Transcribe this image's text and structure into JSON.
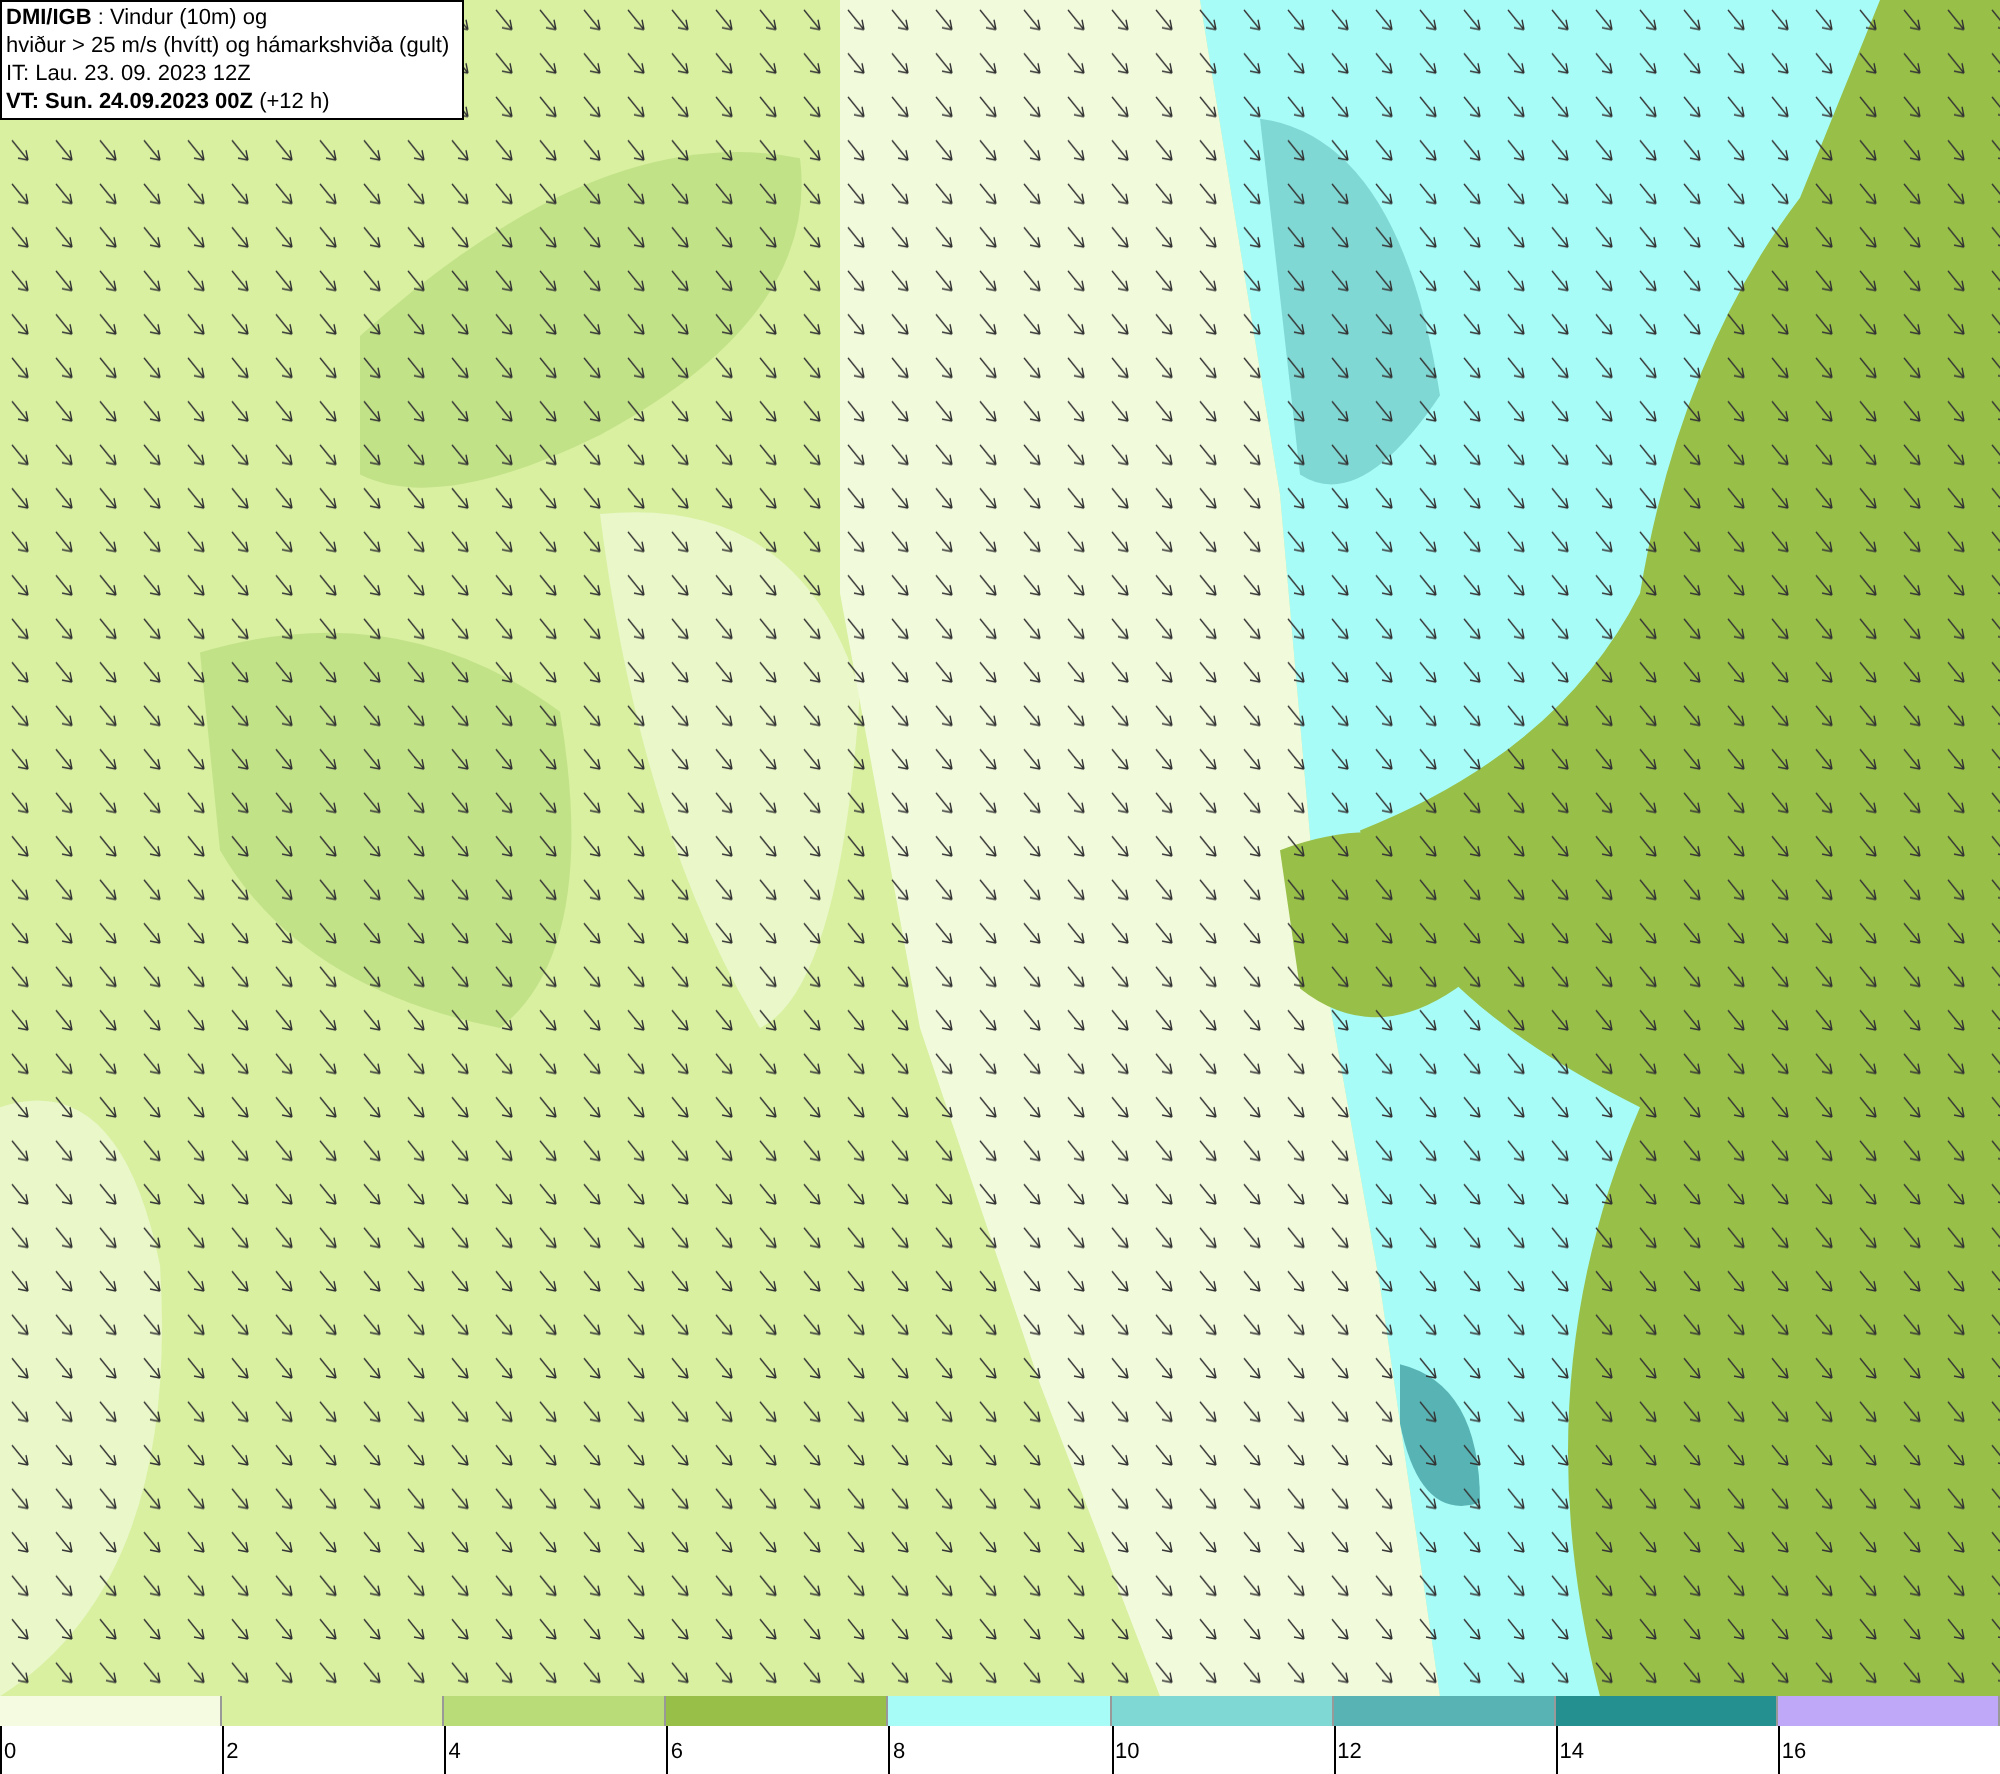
{
  "header": {
    "lines": [
      "**DMI/IGB** : Vindur (10m) og",
      "hviður > 25 m/s (hvítt) og hámarkshviða (gult)",
      "IT: Lau. 23. 09. 2023 12Z",
      "**VT: Sun. 24.09.2023 00Z** (+12 h)"
    ]
  },
  "legend": {
    "bins": [
      {
        "label": "0",
        "color": "#f4fbe0"
      },
      {
        "label": "2",
        "color": "#d8f0a0"
      },
      {
        "label": "4",
        "color": "#b9dc78"
      },
      {
        "label": "6",
        "color": "#98c048"
      },
      {
        "label": "8",
        "color": "#a8fcf8"
      },
      {
        "label": "10",
        "color": "#80d8d4"
      },
      {
        "label": "12",
        "color": "#58b4b4"
      },
      {
        "label": "14",
        "color": "#249090"
      },
      {
        "label": "16",
        "color": "#c0a8f8"
      }
    ]
  }
}
